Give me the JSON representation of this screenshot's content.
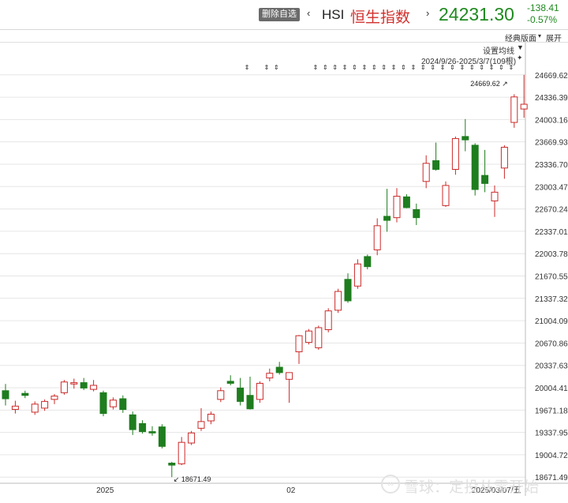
{
  "header": {
    "watchlist_button": "删除自选",
    "prev_arrow": "‹",
    "next_arrow": "›",
    "symbol": "HSI",
    "symbol_name": "恒生指数",
    "last_price": "24231.30",
    "change": "-138.41",
    "change_pct": "-0.57%",
    "price_color": "#1f8a1f"
  },
  "subbar": {
    "classic_layout": "经典版面",
    "expand": "展开",
    "expand_icon": "chevron-down-icon"
  },
  "chart_header": {
    "set_ma": "设置均线",
    "range": "2024/9/26-2025/3/7(109根)"
  },
  "watermark": {
    "text": "雪球：定投从零开始",
    "logo_text": "∞"
  },
  "chart_data": {
    "type": "candlestick",
    "up_color": "#cc2a2a",
    "down_color": "#1e7d1e",
    "ylim": [
      18580,
      24820
    ],
    "y_ticks": [
      "24669.62",
      "24336.39",
      "24003.16",
      "23669.93",
      "23336.70",
      "23003.47",
      "22670.24",
      "22337.01",
      "22003.78",
      "21670.55",
      "21337.32",
      "21004.09",
      "20670.86",
      "20337.63",
      "20004.41",
      "19671.18",
      "19337.95",
      "19004.72",
      "18671.49"
    ],
    "y_tick_values": [
      24669.62,
      24336.39,
      24003.16,
      23669.93,
      23336.7,
      23003.47,
      22670.24,
      22337.01,
      22003.78,
      21670.55,
      21337.32,
      21004.09,
      20670.86,
      20337.63,
      20004.41,
      19671.18,
      19337.95,
      19004.72,
      18671.49
    ],
    "x_labels": [
      {
        "index": 10.5,
        "label": "2025"
      },
      {
        "index": 29.5,
        "label": "02"
      },
      {
        "index": 50.5,
        "label": "2025/03/07/五"
      }
    ],
    "high_annotation": {
      "index": 52,
      "value": 24669.62,
      "label": "24669.62"
    },
    "low_annotation": {
      "index": 17,
      "value": 18671.49,
      "label": "18671.49"
    },
    "event_markers": [
      25,
      27,
      28,
      32,
      33,
      34,
      35,
      36,
      37,
      38,
      39,
      40,
      41,
      42,
      43,
      44,
      45,
      46,
      47,
      48,
      49,
      50,
      51,
      52
    ],
    "event_marker_glyph": "⇕",
    "candles": [
      {
        "o": 19960,
        "h": 20060,
        "l": 19740,
        "c": 19840
      },
      {
        "o": 19680,
        "h": 19810,
        "l": 19620,
        "c": 19730
      },
      {
        "o": 19920,
        "h": 19960,
        "l": 19850,
        "c": 19890
      },
      {
        "o": 19640,
        "h": 19800,
        "l": 19600,
        "c": 19760
      },
      {
        "o": 19700,
        "h": 19830,
        "l": 19660,
        "c": 19800
      },
      {
        "o": 19830,
        "h": 19910,
        "l": 19760,
        "c": 19880
      },
      {
        "o": 19930,
        "h": 20120,
        "l": 19900,
        "c": 20090
      },
      {
        "o": 20060,
        "h": 20140,
        "l": 19990,
        "c": 20080
      },
      {
        "o": 20080,
        "h": 20150,
        "l": 19970,
        "c": 20000
      },
      {
        "o": 19980,
        "h": 20120,
        "l": 19950,
        "c": 20040
      },
      {
        "o": 19930,
        "h": 19960,
        "l": 19580,
        "c": 19620
      },
      {
        "o": 19720,
        "h": 19860,
        "l": 19680,
        "c": 19820
      },
      {
        "o": 19840,
        "h": 19890,
        "l": 19630,
        "c": 19680
      },
      {
        "o": 19600,
        "h": 19650,
        "l": 19300,
        "c": 19380
      },
      {
        "o": 19470,
        "h": 19520,
        "l": 19320,
        "c": 19350
      },
      {
        "o": 19350,
        "h": 19430,
        "l": 19290,
        "c": 19330
      },
      {
        "o": 19420,
        "h": 19460,
        "l": 19100,
        "c": 19130
      },
      {
        "o": 18880,
        "h": 18900,
        "l": 18671,
        "c": 18850
      },
      {
        "o": 18870,
        "h": 19270,
        "l": 18850,
        "c": 19190
      },
      {
        "o": 19180,
        "h": 19360,
        "l": 19150,
        "c": 19330
      },
      {
        "o": 19400,
        "h": 19700,
        "l": 19360,
        "c": 19500
      },
      {
        "o": 19510,
        "h": 19650,
        "l": 19460,
        "c": 19610
      },
      {
        "o": 19830,
        "h": 20010,
        "l": 19790,
        "c": 19960
      },
      {
        "o": 20100,
        "h": 20190,
        "l": 20040,
        "c": 20070
      },
      {
        "o": 20000,
        "h": 20150,
        "l": 19740,
        "c": 19800
      },
      {
        "o": 19890,
        "h": 20170,
        "l": 19680,
        "c": 19690
      },
      {
        "o": 19830,
        "h": 20100,
        "l": 19780,
        "c": 20070
      },
      {
        "o": 20150,
        "h": 20290,
        "l": 20100,
        "c": 20220
      },
      {
        "o": 20310,
        "h": 20390,
        "l": 20200,
        "c": 20230
      },
      {
        "o": 20130,
        "h": 20210,
        "l": 19780,
        "c": 20230
      },
      {
        "o": 20540,
        "h": 20790,
        "l": 20360,
        "c": 20780
      },
      {
        "o": 20680,
        "h": 20880,
        "l": 20650,
        "c": 20850
      },
      {
        "o": 20600,
        "h": 20930,
        "l": 20570,
        "c": 20900
      },
      {
        "o": 20870,
        "h": 21190,
        "l": 20830,
        "c": 21150
      },
      {
        "o": 21160,
        "h": 21480,
        "l": 21120,
        "c": 21440
      },
      {
        "o": 21620,
        "h": 21710,
        "l": 21270,
        "c": 21300
      },
      {
        "o": 21520,
        "h": 21920,
        "l": 21480,
        "c": 21850
      },
      {
        "o": 21960,
        "h": 21990,
        "l": 21770,
        "c": 21810
      },
      {
        "o": 22060,
        "h": 22530,
        "l": 21980,
        "c": 22420
      },
      {
        "o": 22560,
        "h": 22970,
        "l": 22330,
        "c": 22500
      },
      {
        "o": 22540,
        "h": 22980,
        "l": 22470,
        "c": 22860
      },
      {
        "o": 22850,
        "h": 22890,
        "l": 22680,
        "c": 22690
      },
      {
        "o": 22660,
        "h": 22750,
        "l": 22430,
        "c": 22540
      },
      {
        "o": 23080,
        "h": 23470,
        "l": 22980,
        "c": 23350
      },
      {
        "o": 23390,
        "h": 23660,
        "l": 23240,
        "c": 23260
      },
      {
        "o": 22720,
        "h": 23080,
        "l": 22700,
        "c": 23020
      },
      {
        "o": 23260,
        "h": 23750,
        "l": 23180,
        "c": 23720
      },
      {
        "o": 23750,
        "h": 24010,
        "l": 23530,
        "c": 23700
      },
      {
        "o": 23620,
        "h": 23650,
        "l": 22870,
        "c": 22960
      },
      {
        "o": 23170,
        "h": 23550,
        "l": 22920,
        "c": 23050
      },
      {
        "o": 22790,
        "h": 23020,
        "l": 22550,
        "c": 22920
      },
      {
        "o": 23280,
        "h": 23620,
        "l": 23120,
        "c": 23590
      },
      {
        "o": 23960,
        "h": 24380,
        "l": 23880,
        "c": 24340
      },
      {
        "o": 24160,
        "h": 24669,
        "l": 24030,
        "c": 24231
      }
    ]
  }
}
